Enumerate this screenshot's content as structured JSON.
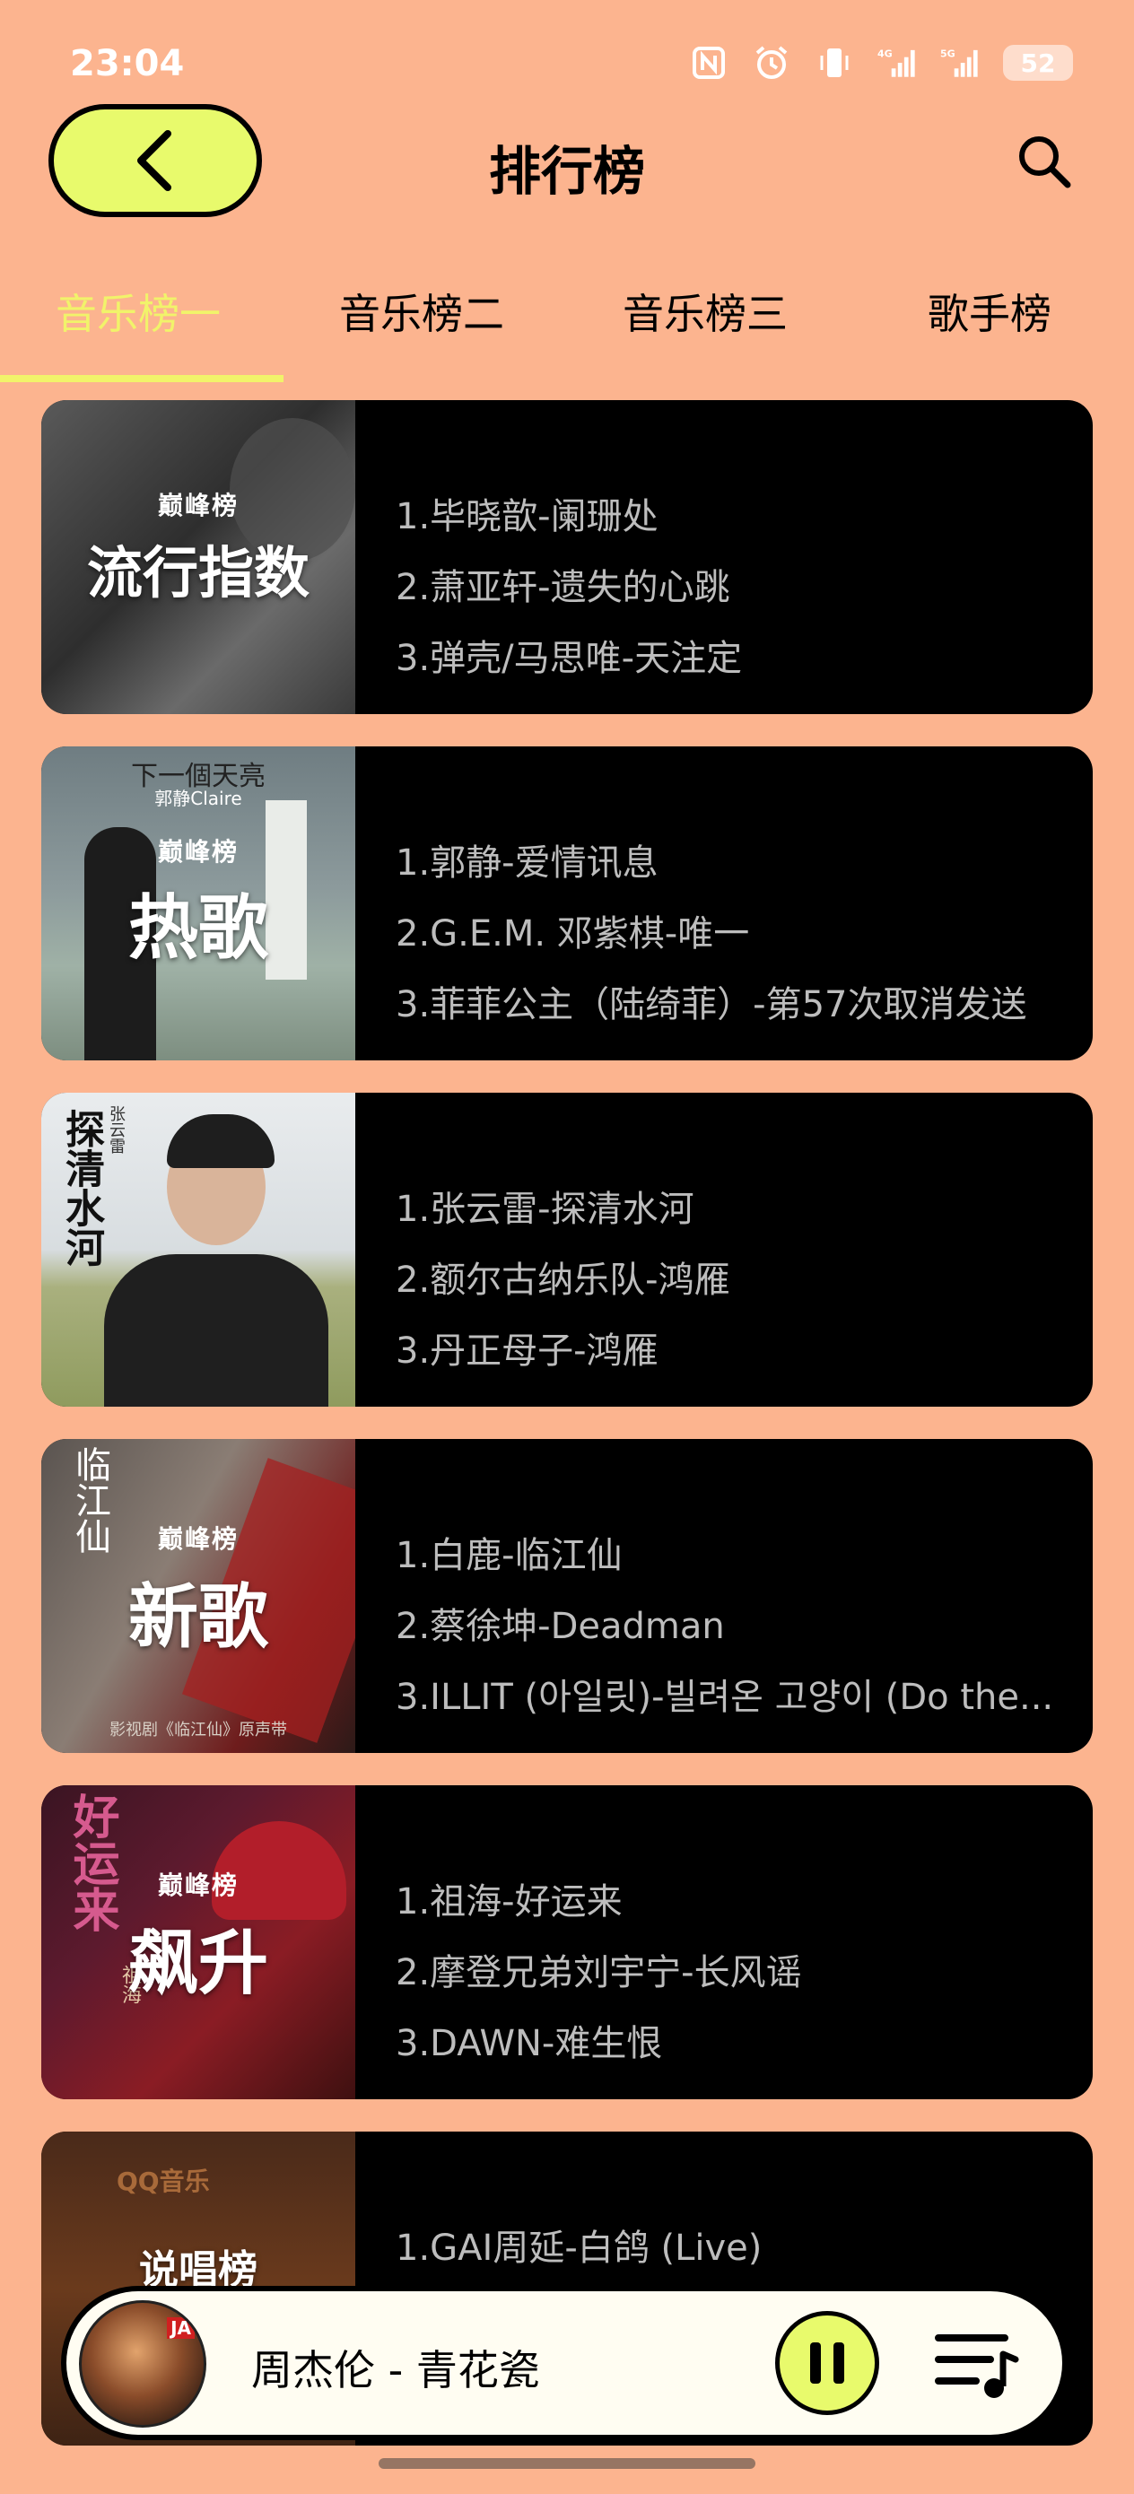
{
  "status": {
    "time": "23:04",
    "signal1": "4G",
    "signal2": "5G",
    "battery": "52"
  },
  "header": {
    "title": "排行榜"
  },
  "tabs": [
    {
      "label": "音乐榜一",
      "active": true
    },
    {
      "label": "音乐榜二",
      "active": false
    },
    {
      "label": "音乐榜三",
      "active": false
    },
    {
      "label": "歌手榜",
      "active": false
    }
  ],
  "charts": [
    {
      "logo": "巅峰榜",
      "title": "流行指数",
      "tracks": [
        "1.毕晓歆-阑珊处",
        "2.萧亚轩-遗失的心跳",
        "3.弹壳/马思唯-天注定"
      ]
    },
    {
      "logo": "巅峰榜",
      "title": "热歌",
      "cover_text": "下一個天亮",
      "cover_subtext": "郭静Claire",
      "tracks": [
        "1.郭静-爱情讯息",
        "2.G.E.M. 邓紫棋-唯一",
        "3.菲菲公主（陆绮菲）-第57次取消发送"
      ]
    },
    {
      "cover_text": "探清水河",
      "cover_subtext": "张云雷",
      "tracks": [
        "1.张云雷-探清水河",
        "2.额尔古纳乐队-鸿雁",
        "3.丹正母子-鸿雁"
      ]
    },
    {
      "logo": "巅峰榜",
      "title": "新歌",
      "cover_text": "临江仙",
      "cover_subtext": "影视剧《临江仙》原声带",
      "tracks": [
        "1.白鹿-临江仙",
        "2.蔡徐坤-Deadman",
        "3.ILLIT (아일릿)-빌려온 고양이 (Do the..."
      ]
    },
    {
      "logo": "巅峰榜",
      "title": "飙升",
      "cover_text": "好运来",
      "cover_subtext": "祖海",
      "tracks": [
        "1.祖海-好运来",
        "2.摩登兄弟刘宇宁-长风谣",
        "3.DAWN-难生恨"
      ]
    },
    {
      "cover_text": "QQ音乐",
      "title": "说唱榜",
      "tracks": [
        "1.GAI周延-白鸽 (Live)"
      ]
    }
  ],
  "player": {
    "song": "周杰伦 - 青花瓷",
    "art_badge": "JA"
  },
  "colors": {
    "background": "#fcb48f",
    "accent": "#e8fa6c",
    "active_tab": "#f1f36a",
    "card": "#000000"
  }
}
